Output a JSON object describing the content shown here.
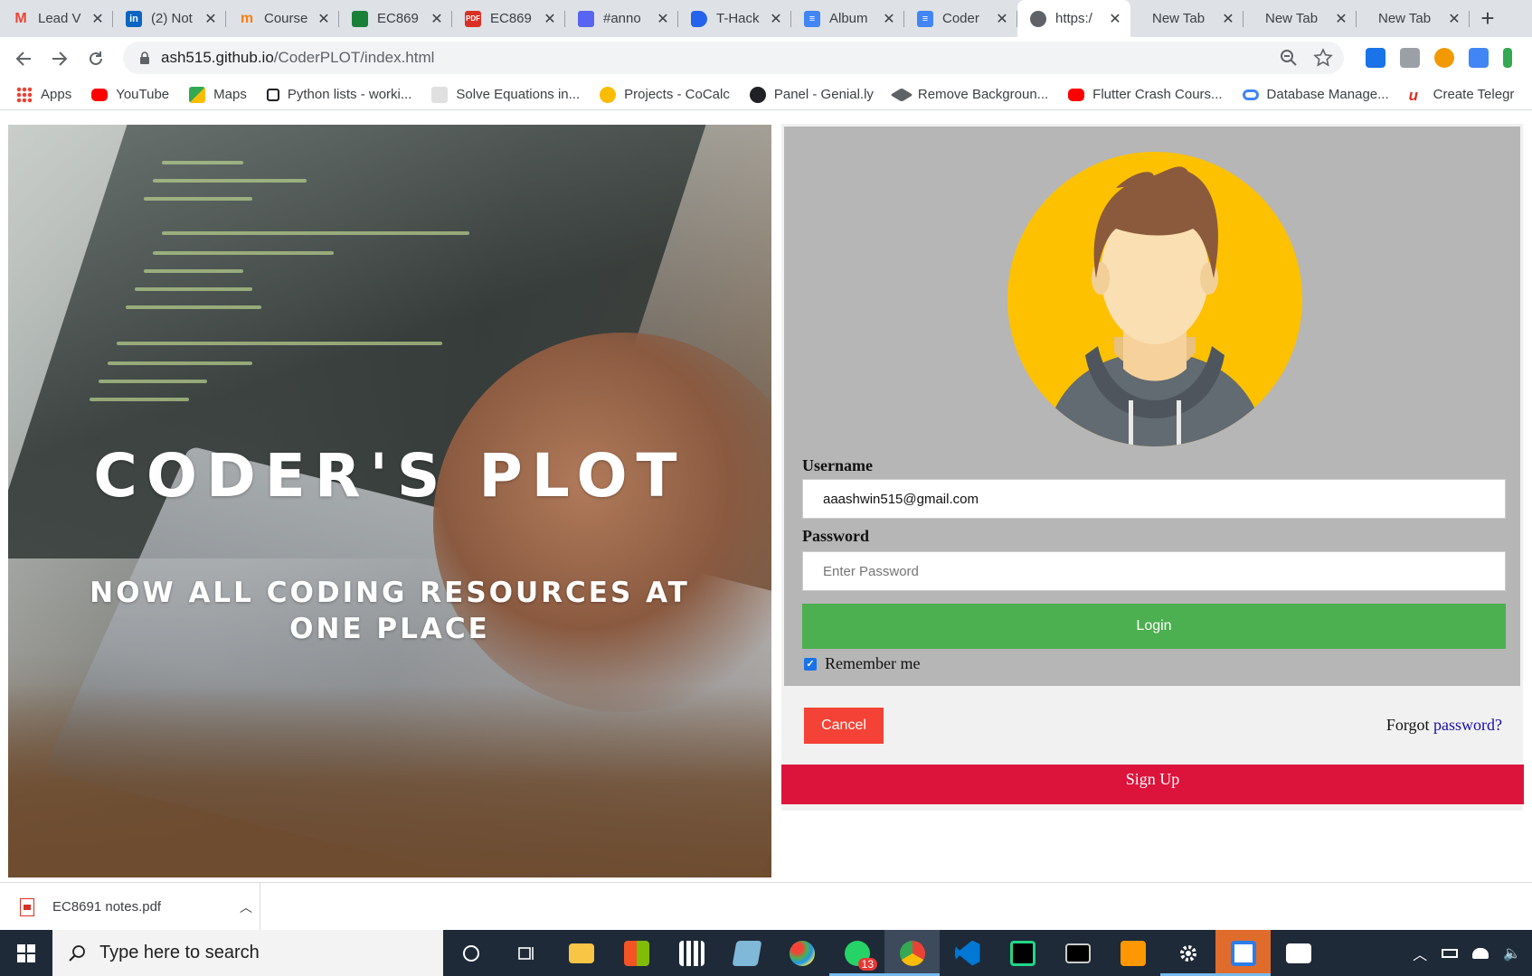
{
  "tabs": [
    {
      "title": "Lead V",
      "icon": "gmail-icon",
      "color": "#ea4335"
    },
    {
      "title": "(2) Not",
      "icon": "linkedin-icon",
      "color": "#0a66c2"
    },
    {
      "title": "Course",
      "icon": "moodle-icon",
      "color": "#f98012"
    },
    {
      "title": "EC869",
      "icon": "document-icon",
      "color": "#188038"
    },
    {
      "title": "EC869",
      "icon": "pdf-icon",
      "color": "#d93025"
    },
    {
      "title": "#anno",
      "icon": "discord-icon",
      "color": "#5865f2"
    },
    {
      "title": "T-Hack",
      "icon": "dev-icon",
      "color": "#2563eb"
    },
    {
      "title": "Album",
      "icon": "google-docs-icon",
      "color": "#4285f4"
    },
    {
      "title": "Coder",
      "icon": "google-docs-icon",
      "color": "#4285f4"
    },
    {
      "title": "https:/",
      "icon": "globe-icon",
      "color": "#5f6368"
    },
    {
      "title": "New Tab",
      "icon": "",
      "color": ""
    },
    {
      "title": "New Tab",
      "icon": "",
      "color": ""
    },
    {
      "title": "New Tab",
      "icon": "",
      "color": ""
    }
  ],
  "url": {
    "host": "ash515.github.io",
    "path": "/CoderPLOT/index.html"
  },
  "bookmarks": [
    {
      "label": "Apps",
      "icon": "apps-icon",
      "color": "#ea4335"
    },
    {
      "label": "YouTube",
      "icon": "youtube-icon",
      "color": "#ff0000"
    },
    {
      "label": "Maps",
      "icon": "maps-icon",
      "color": "#34a853"
    },
    {
      "label": "Python lists - worki...",
      "icon": "page-icon",
      "color": "#202124"
    },
    {
      "label": "Solve Equations in...",
      "icon": "solver-icon",
      "color": "#9aa0a6"
    },
    {
      "label": "Projects - CoCalc",
      "icon": "cocalc-icon",
      "color": "#fbbc04"
    },
    {
      "label": "Panel - Genial.ly",
      "icon": "genially-icon",
      "color": "#202124"
    },
    {
      "label": "Remove Backgroun...",
      "icon": "layers-icon",
      "color": "#5f6368"
    },
    {
      "label": "Flutter Crash Cours...",
      "icon": "youtube-icon",
      "color": "#ff0000"
    },
    {
      "label": "Database Manage...",
      "icon": "link-icon",
      "color": "#4285f4"
    },
    {
      "label": "Create Telegr",
      "icon": "u-icon",
      "color": "#d93025"
    }
  ],
  "hero": {
    "title": "CODER'S PLOT",
    "subtitle": "NOW ALL CODING RESOURCES AT ONE PLACE"
  },
  "login": {
    "username_label": "Username",
    "username_value": "aaashwin515@gmail.com",
    "password_label": "Password",
    "password_placeholder": "Enter Password",
    "login_label": "Login",
    "remember_label": "Remember me",
    "remember_checked": true,
    "cancel_label": "Cancel",
    "forgot_text": "Forgot ",
    "forgot_link": "password?",
    "signup_label": "Sign Up"
  },
  "download": {
    "filename": "EC8691 notes.pdf"
  },
  "taskbar": {
    "search_placeholder": "Type here to search",
    "whatsapp_badge": "13"
  },
  "colors": {
    "accent_green": "#4caf50",
    "cancel_red": "#f44336",
    "signup_crimson": "#dc143c",
    "avatar_yellow": "#fdc100"
  }
}
